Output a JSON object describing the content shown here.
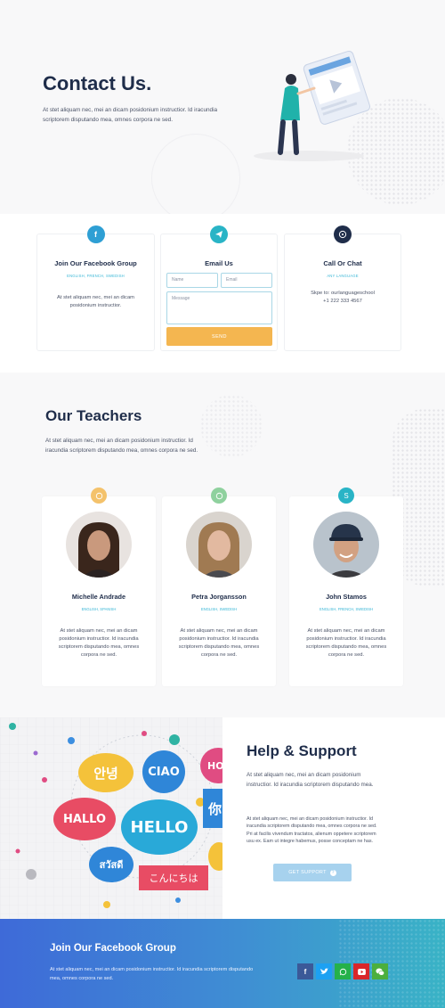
{
  "hero": {
    "title": "Contact Us.",
    "text": "At stet aliquam nec, mei an dicam posidonium instructior. Id iracundia scriptorem disputando mea, omnes corpora ne sed."
  },
  "contact": {
    "facebook": {
      "icon": "facebook-icon",
      "title": "Join Our Facebook Group",
      "tag": "ENGLISH, FRENCH, SWEDISH",
      "text": "At stet aliquam nec, mei an dicam posidonium instructior."
    },
    "email": {
      "icon": "telegram-icon",
      "title": "Email Us",
      "name_placeholder": "Name",
      "email_placeholder": "Email",
      "message_placeholder": "Message",
      "send_label": "SEND"
    },
    "call": {
      "icon": "whatsapp-icon",
      "title": "Call Or Chat",
      "tag": "ANY LANGUAGE",
      "skype": "Skpe to: ourlanguageschool",
      "phone": "+1 222 333 4567"
    }
  },
  "teachers": {
    "title": "Our Teachers",
    "text": "At stet aliquam nec, mei an dicam posidonium instructior. Id iracundia scriptorem disputando mea, omnes corpora ne sed.",
    "items": [
      {
        "name": "Michelle Andrade",
        "tag": "ENGLISH, SPANISH",
        "icon": "whatsapp-icon",
        "text": "At stet aliquam nec, mei an dicam posidonium instructior. Id iracundia scriptorem disputando mea, omnes corpora ne sed."
      },
      {
        "name": "Petra Jorgansson",
        "tag": "ENGLISH, SWEDISH",
        "icon": "whatsapp-icon",
        "text": "At stet aliquam nec, mei an dicam posidonium instructior. Id iracundia scriptorem disputando mea, omnes corpora ne sed."
      },
      {
        "name": "John Stamos",
        "tag": "ENGLISH, FRENCH, SWEDISH",
        "icon": "skype-icon",
        "text": "At stet aliquam nec, mei an dicam posidonium instructior. Id iracundia scriptorem disputando mea, omnes corpora ne sed."
      }
    ]
  },
  "help": {
    "title": "Help & Support",
    "text1": "At stet aliquam nec, mei an dicam posidonium instructior. Id iracundia scriptorem disputando mea.",
    "text2": "At stet aliquam nec, mei an dicam posidonium instructior. Id iracundia scriptorem disputando mea, omnes corpora ne sed. Pri at facilis vivendum tractatos, alienum oppetere scriptorem usu ex. Eam ut integre habemus, posse conceptam ne has.",
    "button": "GET SUPPORT",
    "bubbles": [
      "안녕",
      "CIAO",
      "HO",
      "HALLO",
      "HELLO",
      "你",
      "สวัสดี",
      "こんにちは"
    ]
  },
  "footer": {
    "title": "Join Our Facebook Group",
    "text": "At stet aliquam nec, mei an dicam posidonium instructior. Id iracundia scriptorem disputando mea, omnes corpora ne sed.",
    "socials": [
      "facebook-icon",
      "twitter-icon",
      "whatsapp-icon",
      "youtube-icon",
      "wechat-icon"
    ]
  },
  "colors": {
    "navy": "#1f2d4a",
    "accent_blue": "#38b6d6",
    "send_orange": "#f4b650",
    "support_button": "#a7d2ee"
  }
}
